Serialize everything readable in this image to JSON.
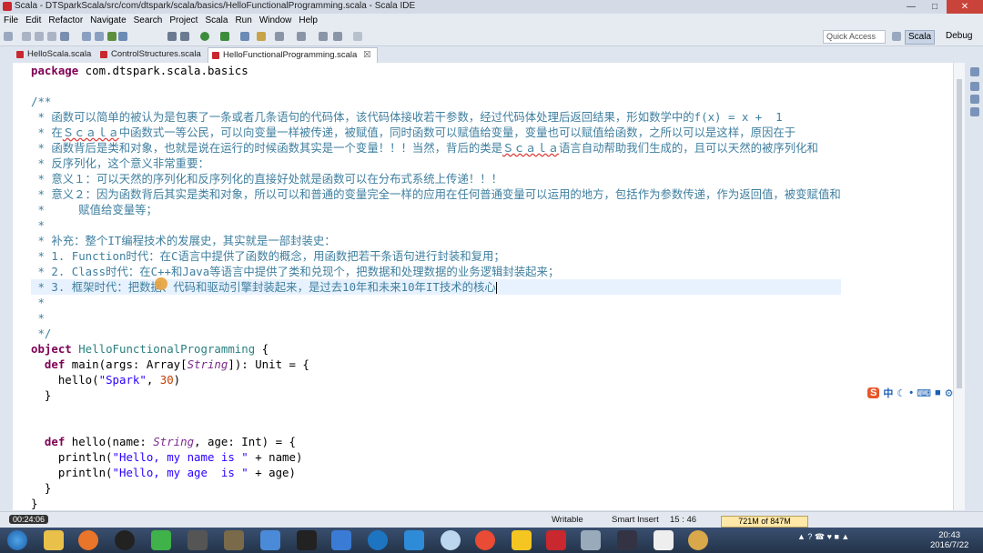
{
  "window": {
    "title": "Scala - DTSparkScala/src/com/dtspark/scala/basics/HelloFunctionalProgramming.scala - Scala IDE"
  },
  "menu": [
    "File",
    "Edit",
    "Refactor",
    "Navigate",
    "Search",
    "Project",
    "Scala",
    "Run",
    "Window",
    "Help"
  ],
  "toolbar": {
    "quick_access_placeholder": "Quick Access",
    "perspectives": [
      "Scala",
      "Debug"
    ]
  },
  "tabs": [
    {
      "label": "HelloScala.scala"
    },
    {
      "label": "ControlStructures.scala"
    },
    {
      "label": "HelloFunctionalProgramming.scala",
      "close": "☒"
    }
  ],
  "code": {
    "l1_kw": "package",
    "l1_rest": " com.dtspark.scala.basics",
    "c1": "/**",
    "c2": " * 函数可以简单的被认为是包裹了一条或者几条语句的代码体，该代码体接收若干参数，经过代码体处理后返回结果，形如数学中的f(x) = x +  1",
    "c3a": " * 在",
    "c3b": "Ｓｃａｌａ",
    "c3c": "中函数式一等公民，可以向变量一样被传递，被赋值，同时函数可以赋值给变量，变量也可以赋值给函数，之所以可以是这样，原因在于",
    "c4a": " * 函数背后是类和对象，也就是说在运行的时候函数其实是一个变量！！！当然，背后的类是",
    "c4b": "Ｓｃａｌａ",
    "c4c": "语言自动帮助我们生成的，且可以天然的被序列化和",
    "c5": " * 反序列化，这个意义非常重要：",
    "c6": " * 意义１：可以天然的序列化和反序列化的直接好处就是函数可以在分布式系统上传递！！！",
    "c7": " * 意义２：因为函数背后其实是类和对象，所以可以和普通的变量完全一样的应用在任何普通变量可以运用的地方，包括作为参数传递，作为返回值，被变赋值和",
    "c8": " *     赋值给变量等；",
    "c9": " *",
    "c10": " * 补充：整个IT编程技术的发展史，其实就是一部封装史：",
    "c11": " * 1. Function时代：在C语言中提供了函数的概念，用函数把若干条语句进行封装和复用；",
    "c12": " * 2. Class时代：在C++和Java等语言中提供了类和兑现个，把数据和处理数据的业务逻辑封装起来；",
    "c13": " * 3. 框架时代：把数据、代码和驱动引擎封装起来，是过去10年和未来10年IT技术的核心",
    "c14": " *",
    "c15": " *",
    "c16": " */",
    "o_kw": "object",
    "o_name": " HelloFunctionalProgramming",
    "o_brace": " {",
    "m_indent": "  ",
    "m_kw": "def",
    "m_a": " main(args: Array[",
    "m_ty": "String",
    "m_b": "]): Unit = {",
    "h_a": "    hello(",
    "h_str": "\"Spark\"",
    "h_b": ", ",
    "h_num": "30",
    "h_c": ")",
    "close1": "  }",
    "blank": " ",
    "d_indent": "  ",
    "d_kw": "def",
    "d_a": " hello(name: ",
    "d_ty": "String",
    "d_b": ", age: Int) = {",
    "p1_a": "    println(",
    "p1_str": "\"Hello, my name is \"",
    "p1_b": " + name)",
    "p2_a": "    println(",
    "p2_str": "\"Hello, my age  is \"",
    "p2_b": " + age)",
    "close2": "  }",
    "close3": "}"
  },
  "status": {
    "timer": "00:24:06",
    "writable": "Writable",
    "insert_mode": "Smart Insert",
    "position": "15 : 46",
    "memory": "721M of 847M"
  },
  "taskbar": {
    "time": "20:43",
    "date": "2016/7/22"
  },
  "ime": {
    "label": "中"
  },
  "colors": {
    "keyword": "#7f0055",
    "comment": "#3f7f9f",
    "string": "#2a00ff",
    "number": "#c04000"
  }
}
